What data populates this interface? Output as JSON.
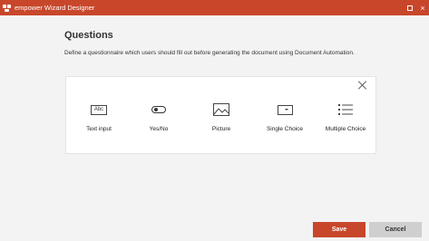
{
  "window": {
    "title": "empower Wizard Designer",
    "accent": "#c8472b",
    "maximize_icon": "maximize-icon",
    "close_symbol": "×"
  },
  "page": {
    "heading": "Questions",
    "description": "Define a questionnaire which users should fill out before generating the document using Document Automation."
  },
  "question_types": [
    {
      "label": "Text input",
      "icon": "text-input-icon",
      "icon_text": "Abc"
    },
    {
      "label": "Yes/No",
      "icon": "toggle-icon"
    },
    {
      "label": "Picture",
      "icon": "picture-icon"
    },
    {
      "label": "Single Choice",
      "icon": "dropdown-icon"
    },
    {
      "label": "Multiple Choice",
      "icon": "list-icon"
    }
  ],
  "footer": {
    "save_label": "Save",
    "cancel_label": "Cancel"
  }
}
